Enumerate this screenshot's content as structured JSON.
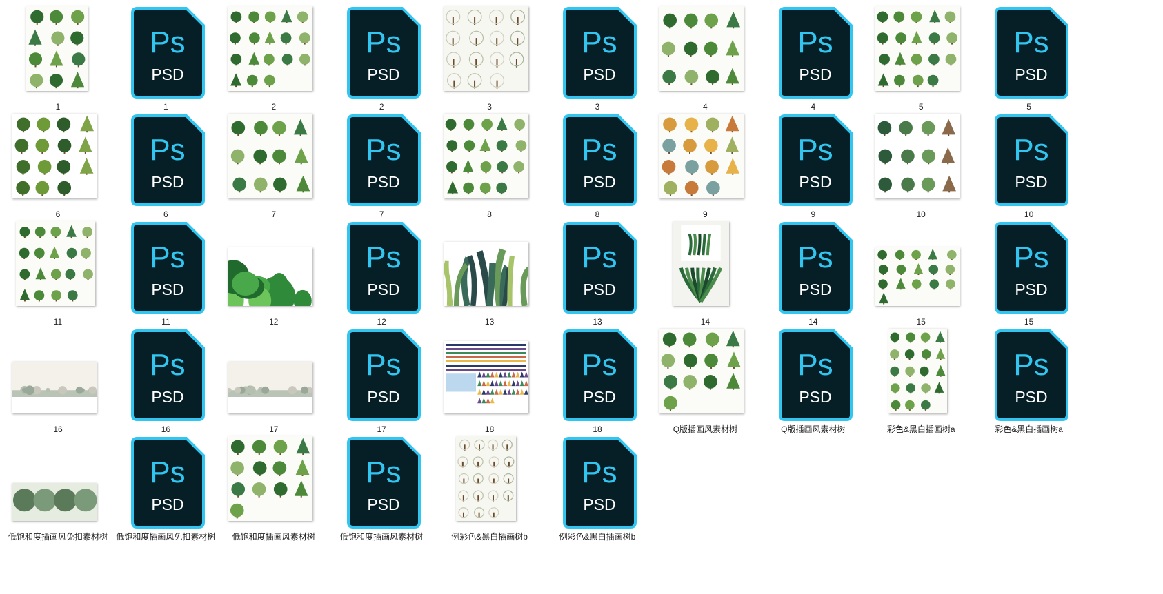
{
  "window": {
    "title": "",
    "view": "large-icons"
  },
  "files": [
    {
      "label": "1",
      "type": "image",
      "icon": "tree-collage-image"
    },
    {
      "label": "1",
      "type": "psd",
      "icon": "photoshop-psd-icon"
    },
    {
      "label": "2",
      "type": "image",
      "icon": "tree-collage-image"
    },
    {
      "label": "2",
      "type": "psd",
      "icon": "photoshop-psd-icon"
    },
    {
      "label": "3",
      "type": "image",
      "icon": "tree-sketch-image"
    },
    {
      "label": "3",
      "type": "psd",
      "icon": "photoshop-psd-icon"
    },
    {
      "label": "4",
      "type": "image",
      "icon": "tree-collage-image"
    },
    {
      "label": "4",
      "type": "psd",
      "icon": "photoshop-psd-icon"
    },
    {
      "label": "5",
      "type": "image",
      "icon": "tree-collage-image"
    },
    {
      "label": "5",
      "type": "psd",
      "icon": "photoshop-psd-icon"
    },
    {
      "label": "6",
      "type": "image",
      "icon": "palm-tree-image"
    },
    {
      "label": "6",
      "type": "psd",
      "icon": "photoshop-psd-icon"
    },
    {
      "label": "7",
      "type": "image",
      "icon": "tree-collage-image"
    },
    {
      "label": "7",
      "type": "psd",
      "icon": "photoshop-psd-icon"
    },
    {
      "label": "8",
      "type": "image",
      "icon": "tree-collage-image"
    },
    {
      "label": "8",
      "type": "psd",
      "icon": "photoshop-psd-icon"
    },
    {
      "label": "9",
      "type": "image",
      "icon": "autumn-tree-image"
    },
    {
      "label": "9",
      "type": "psd",
      "icon": "photoshop-psd-icon"
    },
    {
      "label": "10",
      "type": "image",
      "icon": "plant-collage-image"
    },
    {
      "label": "10",
      "type": "psd",
      "icon": "photoshop-psd-icon"
    },
    {
      "label": "11",
      "type": "image",
      "icon": "tree-collage-image"
    },
    {
      "label": "11",
      "type": "psd",
      "icon": "photoshop-psd-icon"
    },
    {
      "label": "12",
      "type": "image",
      "icon": "bushes-image"
    },
    {
      "label": "12",
      "type": "psd",
      "icon": "photoshop-psd-icon"
    },
    {
      "label": "13",
      "type": "image",
      "icon": "leaves-image"
    },
    {
      "label": "13",
      "type": "psd",
      "icon": "photoshop-psd-icon"
    },
    {
      "label": "14",
      "type": "image",
      "icon": "plant-pot-image"
    },
    {
      "label": "14",
      "type": "psd",
      "icon": "photoshop-psd-icon"
    },
    {
      "label": "15",
      "type": "image",
      "icon": "tree-collage-image"
    },
    {
      "label": "15",
      "type": "psd",
      "icon": "photoshop-psd-icon"
    },
    {
      "label": "16",
      "type": "image",
      "icon": "landscape-strip-image"
    },
    {
      "label": "16",
      "type": "psd",
      "icon": "photoshop-psd-icon"
    },
    {
      "label": "17",
      "type": "image",
      "icon": "landscape-strip-image"
    },
    {
      "label": "17",
      "type": "psd",
      "icon": "photoshop-psd-icon"
    },
    {
      "label": "18",
      "type": "image",
      "icon": "element-sheet-image"
    },
    {
      "label": "18",
      "type": "psd",
      "icon": "photoshop-psd-icon"
    },
    {
      "label": "Q版插画风素材树",
      "type": "image",
      "icon": "tree-collage-image"
    },
    {
      "label": "Q版插画风素材树",
      "type": "psd",
      "icon": "photoshop-psd-icon"
    },
    {
      "label": "彩色&黑白插画树a",
      "type": "image",
      "icon": "tree-collage-image"
    },
    {
      "label": "彩色&黑白插画树a",
      "type": "psd",
      "icon": "photoshop-psd-icon"
    },
    {
      "label": "低饱和度插画风免扣素材树",
      "type": "image",
      "icon": "tree-strip-image"
    },
    {
      "label": "低饱和度插画风免扣素材树",
      "type": "psd",
      "icon": "photoshop-psd-icon"
    },
    {
      "label": "低饱和度插画风素材树",
      "type": "image",
      "icon": "tree-collage-image"
    },
    {
      "label": "低饱和度插画风素材树",
      "type": "psd",
      "icon": "photoshop-psd-icon"
    },
    {
      "label": "例彩色&黑白插画树b",
      "type": "image",
      "icon": "tree-sketch-image"
    },
    {
      "label": "例彩色&黑白插画树b",
      "type": "psd",
      "icon": "photoshop-psd-icon"
    }
  ],
  "psd_icon": {
    "ps_text": "Ps",
    "ext_text": "PSD",
    "bg": "#061e26",
    "border": "#31c5f0",
    "text_color": "#31c5f0",
    "ext_color": "#ffffff"
  }
}
